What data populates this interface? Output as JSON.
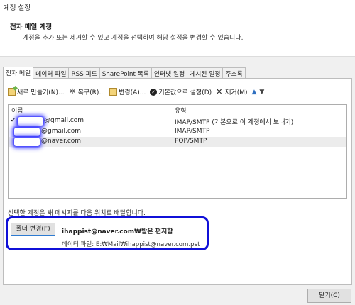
{
  "window": {
    "title": "계정 설정"
  },
  "header": {
    "title": "전자 메일 계정",
    "description": "계정을 추가 또는 제거할 수 있고 계정을 선택하여 해당 설정을 변경할 수 있습니다."
  },
  "tabs": [
    {
      "label": "전자 메일",
      "active": true
    },
    {
      "label": "데이터 파일"
    },
    {
      "label": "RSS 피드"
    },
    {
      "label": "SharePoint 목록"
    },
    {
      "label": "인터넷 일정"
    },
    {
      "label": "게시된 일정"
    },
    {
      "label": "주소록"
    }
  ],
  "toolbar": {
    "new_label": "새로 만들기(N)...",
    "repair_label": "복구(R)...",
    "change_label": "변경(A)...",
    "default_label": "기본값으로 설정(D)",
    "remove_label": "제거(M)",
    "up_icon": "▲",
    "down_icon": "▼"
  },
  "list": {
    "columns": {
      "name": "이름",
      "type": "유형"
    },
    "rows": [
      {
        "name": "@gmail.com",
        "type": "IMAP/SMTP (기본으로 이 계정에서 보내기)",
        "default": true
      },
      {
        "name": "@gmail.com",
        "type": "IMAP/SMTP"
      },
      {
        "name": "@naver.com",
        "type": "POP/SMTP",
        "selected": true
      }
    ]
  },
  "delivery": {
    "text": "선택한 계정은 새 메시지를 다음 위치로 배달합니다.",
    "folder_button": "폴더 변경(F)",
    "folder_path": "ihappist@naver.com₩받은 편지함",
    "data_file": "데이터 파일: E:₩Mail₩ihappist@naver.com.pst"
  },
  "footer": {
    "close_label": "닫기(C)"
  },
  "colors": {
    "highlight_border": "#1010d8",
    "redaction_glow": "#4b4bff"
  }
}
